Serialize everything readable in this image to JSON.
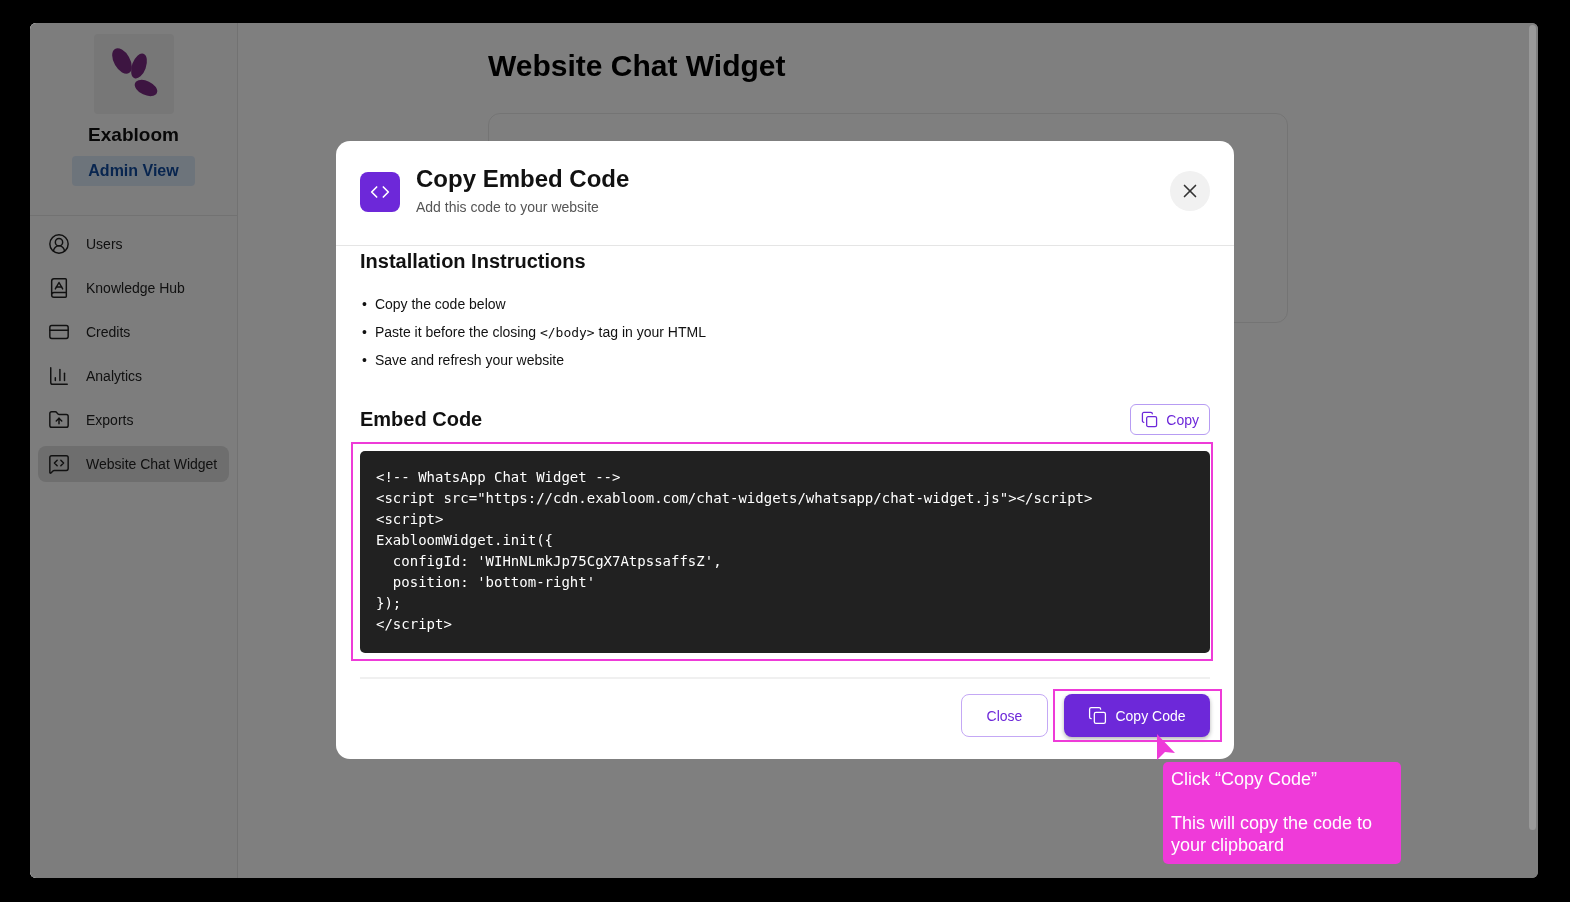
{
  "sidebar": {
    "brand": "Exabloom",
    "badge": "Admin View",
    "items": [
      {
        "label": "Users",
        "selected": false
      },
      {
        "label": "Knowledge Hub",
        "selected": false
      },
      {
        "label": "Credits",
        "selected": false
      },
      {
        "label": "Analytics",
        "selected": false
      },
      {
        "label": "Exports",
        "selected": false
      },
      {
        "label": "Website Chat Widget",
        "selected": true
      }
    ]
  },
  "page": {
    "title": "Website Chat Widget"
  },
  "modal": {
    "title": "Copy Embed Code",
    "subtitle": "Add this code to your website",
    "instructions_title": "Installation Instructions",
    "steps": [
      {
        "bullet": "•",
        "text": "Copy the code below"
      },
      {
        "bullet": "•",
        "text": "Paste it before the closing",
        "code": "</body>",
        "after": "tag in your HTML"
      },
      {
        "bullet": "•",
        "text": "Save and refresh your website"
      }
    ],
    "embed_title": "Embed Code",
    "copy_label": "Copy",
    "code_lines": [
      "<!-- WhatsApp Chat Widget -->",
      "<script src=\"https://cdn.exabloom.com/chat-widgets/whatsapp/chat-widget.js\"></script>",
      "<script>",
      "ExabloomWidget.init({",
      "  configId: 'WIHnNLmkJp75CgX7AtpssaffsZ',",
      "  position: 'bottom-right'",
      "});",
      "</script>"
    ],
    "close_label": "Close",
    "copy_code_label": "Copy Code"
  },
  "tutorial": {
    "lines": [
      "Click “Copy Code”",
      "This will copy the code to your clipboard"
    ]
  }
}
